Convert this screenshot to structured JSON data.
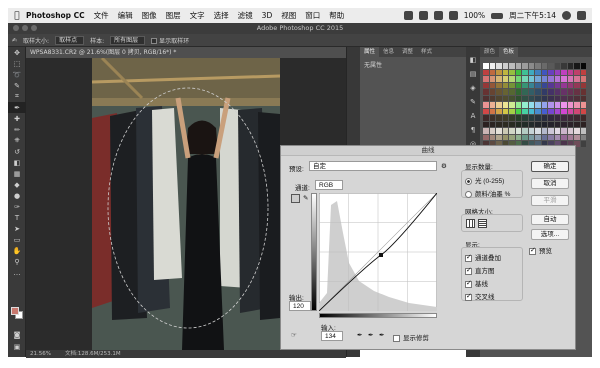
{
  "menubar": {
    "app_name": "Photoshop CC",
    "items": [
      "文件",
      "编辑",
      "图像",
      "图层",
      "文字",
      "选择",
      "滤镜",
      "3D",
      "视图",
      "窗口",
      "帮助"
    ],
    "battery": "100%",
    "clock": "周二下午5:14"
  },
  "window": {
    "title": "Adobe Photoshop CC 2015"
  },
  "options_bar": {
    "sample_label": "取样大小:",
    "sample_value": "取样点",
    "sample_label2": "样本:",
    "sample_value2": "所有图层",
    "show_ring": "显示取样环"
  },
  "document": {
    "tab_title": "WPSA8331.CR2 @ 21.6%(图层 0 拷贝, RGB/16*) *",
    "zoom": "21.56%",
    "doc_size": "文档:128.6M/253.1M"
  },
  "panels": {
    "props_tabs": [
      "属性",
      "信息",
      "调整",
      "样式"
    ],
    "props_empty": "无属性",
    "swatch_tabs": [
      "颜色",
      "色板"
    ]
  },
  "curves": {
    "title": "曲线",
    "preset_label": "预设:",
    "preset_value": "自定",
    "channel_label": "通道:",
    "channel_value": "RGB",
    "output_label": "输出:",
    "output_value": "120",
    "input_label": "输入:",
    "input_value": "134",
    "show_clipping": "显示修剪",
    "display_amount": "显示数量:",
    "light": "光 (0-255)",
    "pigment": "颜料/油墨 %",
    "grid_size": "网格大小:",
    "show": "显示:",
    "channel_overlays": "通道叠加",
    "histogram": "直方图",
    "baseline": "基线",
    "intersection": "交叉线",
    "btn_ok": "确定",
    "btn_cancel": "取消",
    "btn_smooth": "平滑",
    "btn_auto": "自动",
    "btn_options": "选项...",
    "preview": "预览"
  },
  "colors": {
    "accent": "#3478f6",
    "ps_bg": "#2b2b2b",
    "panel": "#535353",
    "dialog": "#d6d6d6",
    "fg_swatch": "#c8786e"
  }
}
